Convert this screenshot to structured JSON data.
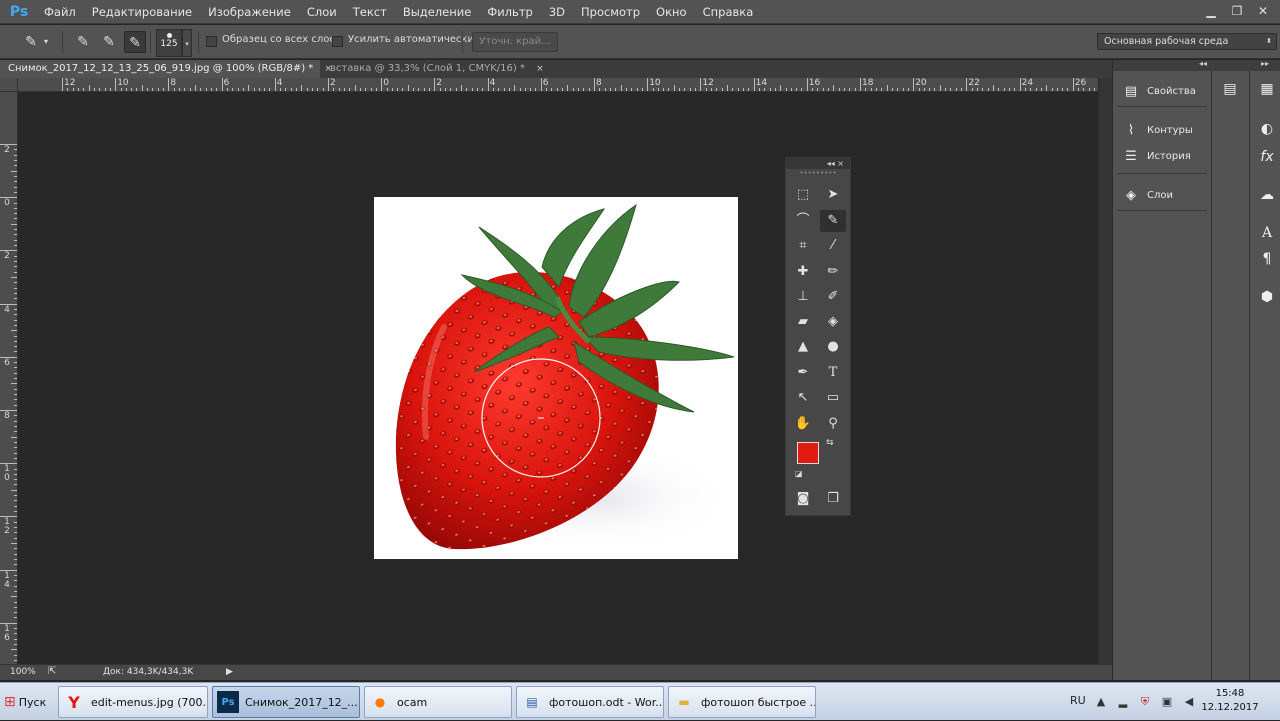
{
  "app": {
    "logo": "Ps"
  },
  "menu": [
    "Файл",
    "Редактирование",
    "Изображение",
    "Слои",
    "Текст",
    "Выделение",
    "Фильтр",
    "3D",
    "Просмотр",
    "Окно",
    "Справка"
  ],
  "window_controls": [
    "minimize-icon",
    "restore-icon",
    "close-icon"
  ],
  "options": {
    "brush_size": "125",
    "sample_all_layers": "Образец со всех слоев",
    "auto_enhance": "Усилить автоматически",
    "refine_edge": "Уточн. край...",
    "workspace": "Основная рабочая среда"
  },
  "tabs": [
    {
      "label": "Снимок_2017_12_12_13_25_06_919.jpg @ 100% (RGB/8#) *",
      "close": "×",
      "active": true
    },
    {
      "label": "вставка @ 33,3% (Слой 1, CMYK/16) *",
      "close": "×",
      "active": false
    }
  ],
  "ruler_top": [
    "12",
    "10",
    "8",
    "6",
    "4",
    "2",
    "0",
    "2",
    "4",
    "6",
    "8",
    "10",
    "12",
    "14",
    "16",
    "18",
    "20",
    "22",
    "24",
    "26"
  ],
  "ruler_left": [
    "2",
    "0",
    "2",
    "4",
    "6",
    "8",
    "10",
    "12",
    "14",
    "16"
  ],
  "status": {
    "zoom": "100%",
    "doc": "Док: 434,3K/434,3K",
    "arrow": "▶"
  },
  "tools_panel": {
    "header": "◂◂ ×",
    "grip": "•••••••••",
    "foreground_color": "#e01c12",
    "background_color": "#ffffff"
  },
  "right_panel": {
    "collapse_top": "◂◂",
    "collapse_side": "▸▸",
    "items": [
      {
        "label": "Свойства",
        "icon": "properties-icon"
      },
      {
        "label": "Контуры",
        "icon": "paths-icon"
      },
      {
        "label": "История",
        "icon": "history-icon"
      },
      {
        "label": "Слои",
        "icon": "layers-icon"
      }
    ]
  },
  "taskbar": {
    "start": "Пуск",
    "tasks": [
      {
        "label": "edit-menus.jpg (700...",
        "icon": "Y"
      },
      {
        "label": "Снимок_2017_12_...",
        "icon": "Ps"
      },
      {
        "label": "ocam",
        "icon": "●"
      },
      {
        "label": "фотошоп.odt - Wor...",
        "icon": "▤"
      },
      {
        "label": "фотошоп быстрое ...",
        "icon": "▬"
      }
    ],
    "lang": "RU",
    "time": "15:48",
    "date": "12.12.2017"
  }
}
